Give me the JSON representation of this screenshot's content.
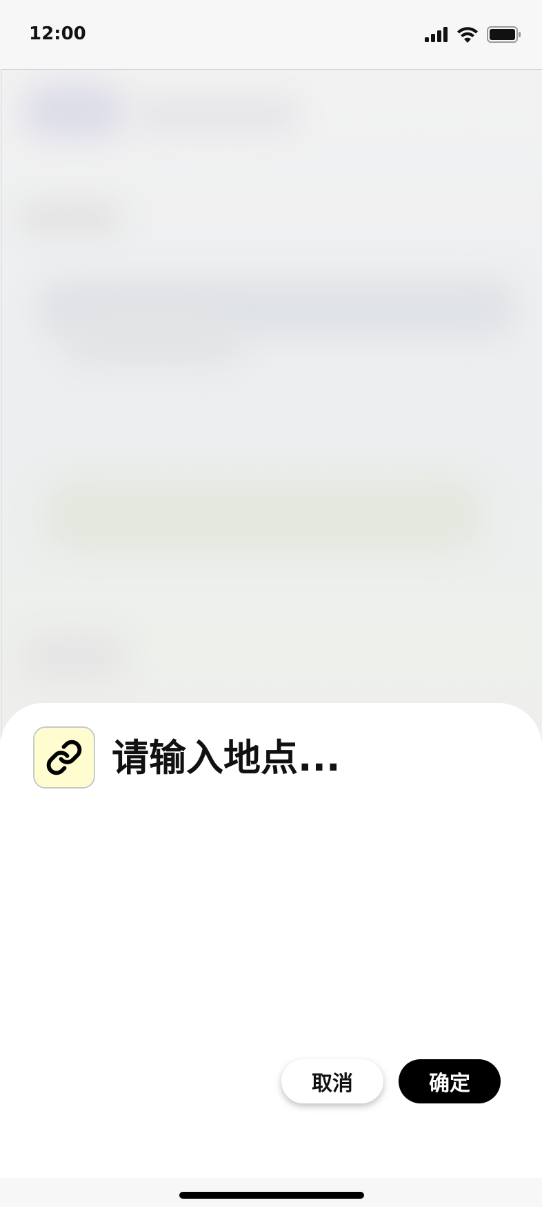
{
  "status_bar": {
    "time": "12:00"
  },
  "sheet": {
    "icon": "link-icon",
    "icon_background": "#fffdd0",
    "title": "请输入地点..."
  },
  "buttons": {
    "cancel_label": "取消",
    "confirm_label": "确定"
  },
  "colors": {
    "confirm_button": "#000000",
    "cancel_button": "#ffffff"
  }
}
